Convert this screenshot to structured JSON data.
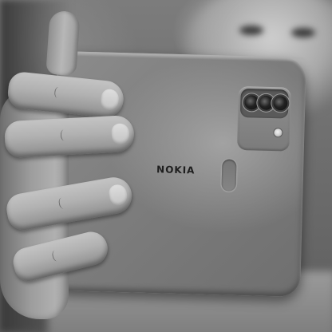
{
  "scene": {
    "subject": "hand-holding-smartphone",
    "style": "grayscale photograph"
  },
  "phone": {
    "brand": "NOKIA",
    "camera_lenses": 3,
    "has_flash": true,
    "has_fingerprint_sensor": true
  }
}
